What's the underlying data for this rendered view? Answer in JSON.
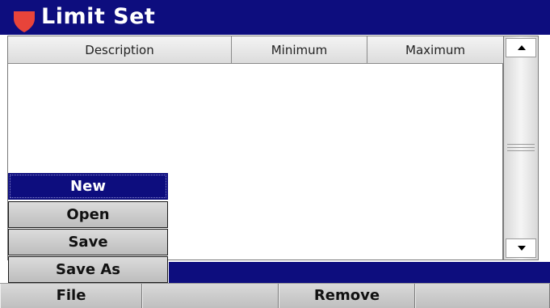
{
  "window": {
    "title": "Limit Set",
    "logo_icon": "red-shield-icon",
    "title_bar_color": "#0d0d7e",
    "logo_color": "#e8443a"
  },
  "table": {
    "columns": [
      "Description",
      "Minimum",
      "Maximum"
    ],
    "rows": []
  },
  "scrollbar": {
    "up_icon": "triangle-up-icon",
    "down_icon": "triangle-down-icon"
  },
  "file_menu": {
    "items": [
      {
        "label": "New",
        "selected": true
      },
      {
        "label": "Open",
        "selected": false
      },
      {
        "label": "Save",
        "selected": false
      },
      {
        "label": "Save As",
        "selected": false
      }
    ]
  },
  "softkeys": [
    "File",
    "",
    "Remove",
    ""
  ]
}
